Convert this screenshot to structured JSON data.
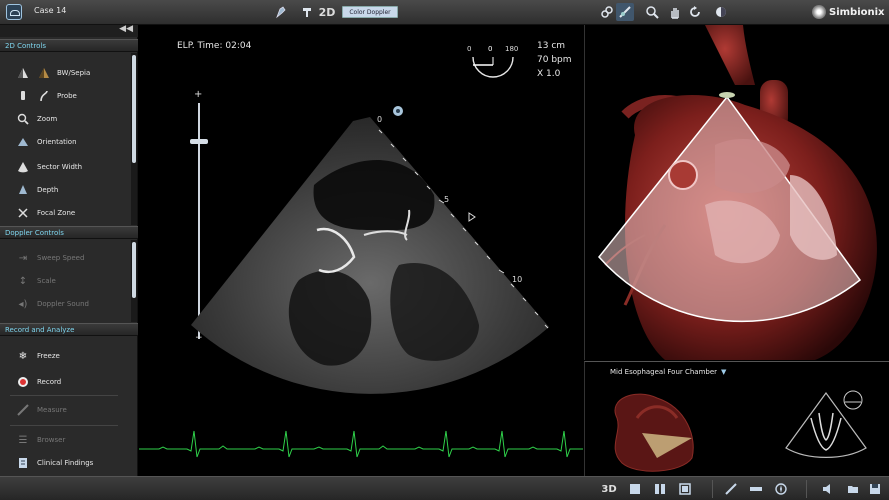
{
  "topbar": {
    "case_label": "Case 14",
    "mode_2d": "2D",
    "mode_button": "Color Doppler",
    "brand": "Simbionix"
  },
  "left_panel": {
    "collapse": "◀◀",
    "sections": [
      {
        "title": "2D Controls",
        "items": [
          {
            "label": "BW/Sepia",
            "icon": "bw-sepia-icon"
          },
          {
            "label": "Probe",
            "icon": "probe-icon"
          },
          {
            "label": "Zoom",
            "icon": "zoom-icon"
          },
          {
            "label": "Orientation",
            "icon": "orientation-icon"
          },
          {
            "label": "Sector Width",
            "icon": "sector-width-icon"
          },
          {
            "label": "Depth",
            "icon": "depth-icon"
          },
          {
            "label": "Focal Zone",
            "icon": "focal-zone-icon"
          }
        ]
      },
      {
        "title": "Doppler Controls",
        "items": [
          {
            "label": "Sweep Speed",
            "icon": "sweep-speed-icon"
          },
          {
            "label": "Scale",
            "icon": "scale-icon"
          },
          {
            "label": "Doppler Sound",
            "icon": "doppler-sound-icon"
          }
        ]
      },
      {
        "title": "Record and Analyze",
        "items": [
          {
            "label": "Freeze",
            "icon": "freeze-icon"
          },
          {
            "label": "Record",
            "icon": "record-icon"
          },
          {
            "label": "Measure",
            "icon": "measure-icon"
          },
          {
            "label": "Browser",
            "icon": "browser-icon"
          },
          {
            "label": "Clinical Findings",
            "icon": "clinical-findings-icon"
          }
        ]
      }
    ]
  },
  "ultrasound": {
    "elapsed_time": "ELP. Time: 02:04",
    "depth": "13 cm",
    "heart_rate": "70 bpm",
    "zoom": "X 1.0",
    "angle_min": "0",
    "angle_value": "0",
    "angle_max": "180",
    "depth_marks": [
      "0",
      "5",
      "10"
    ],
    "gain_plus": "+",
    "gain_minus": "−"
  },
  "view": {
    "name": "Mid Esophageal Four Chamber"
  },
  "bottombar": {
    "mode_3d": "3D"
  }
}
